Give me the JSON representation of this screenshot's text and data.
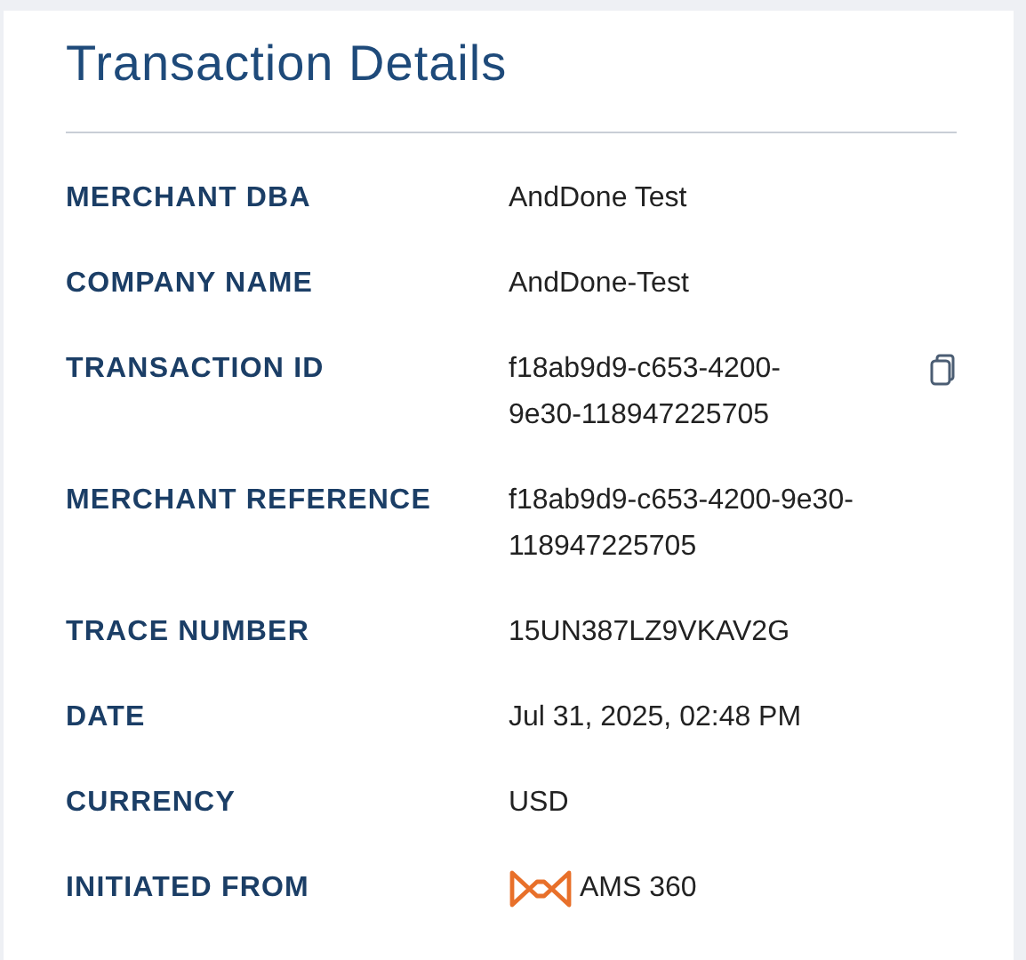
{
  "title": "Transaction Details",
  "rows": [
    {
      "label": "MERCHANT DBA",
      "value_lines": [
        "AndDone Test"
      ],
      "kind": "text"
    },
    {
      "label": "COMPANY NAME",
      "value_lines": [
        "AndDone-Test"
      ],
      "kind": "text"
    },
    {
      "label": "TRANSACTION ID",
      "value_lines": [
        "f18ab9d9-c653-4200-",
        "9e30-118947225705"
      ],
      "kind": "copy"
    },
    {
      "label": "MERCHANT REFERENCE",
      "value_lines": [
        "f18ab9d9-c653-4200-9e30-",
        "118947225705"
      ],
      "kind": "text"
    },
    {
      "label": "TRACE NUMBER",
      "value_lines": [
        "15UN387LZ9VKAV2G"
      ],
      "kind": "text"
    },
    {
      "label": "DATE",
      "value_lines": [
        "Jul 31, 2025, 02:48 PM"
      ],
      "kind": "text"
    },
    {
      "label": "CURRENCY",
      "value_lines": [
        "USD"
      ],
      "kind": "text"
    },
    {
      "label": "INITIATED FROM",
      "value_lines": [
        "AMS 360"
      ],
      "kind": "logo"
    }
  ]
}
